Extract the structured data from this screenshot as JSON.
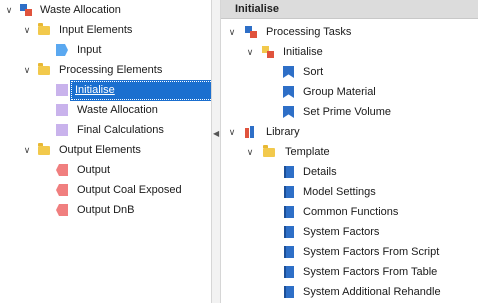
{
  "left_tree": {
    "root": "Waste Allocation",
    "input_elements": "Input Elements",
    "input": "Input",
    "processing_elements": "Processing Elements",
    "initialise": "Initialise",
    "waste_allocation": "Waste Allocation",
    "final_calculations": "Final Calculations",
    "output_elements": "Output Elements",
    "output": "Output",
    "output_coal": "Output Coal Exposed",
    "output_dnb": "Output DnB"
  },
  "right_panel": {
    "header": "Initialise",
    "processing_tasks": "Processing Tasks",
    "initialise": "Initialise",
    "sort": "Sort",
    "group_material": "Group Material",
    "set_prime_volume": "Set Prime Volume",
    "library": "Library",
    "template": "Template",
    "details": "Details",
    "model_settings": "Model Settings",
    "common_functions": "Common Functions",
    "system_factors": "System Factors",
    "system_factors_script": "System Factors From Script",
    "system_factors_table": "System Factors From Table",
    "system_additional_rehandle": "System Additional Rehandle"
  },
  "colors": {
    "selection": "#1b6fcf",
    "folder": "#f2c94c",
    "input_icon": "#5aa8f0",
    "processing_icon": "#c9b3ec",
    "output_icon": "#f07f7f",
    "task_icon": "#2e6fc7"
  }
}
